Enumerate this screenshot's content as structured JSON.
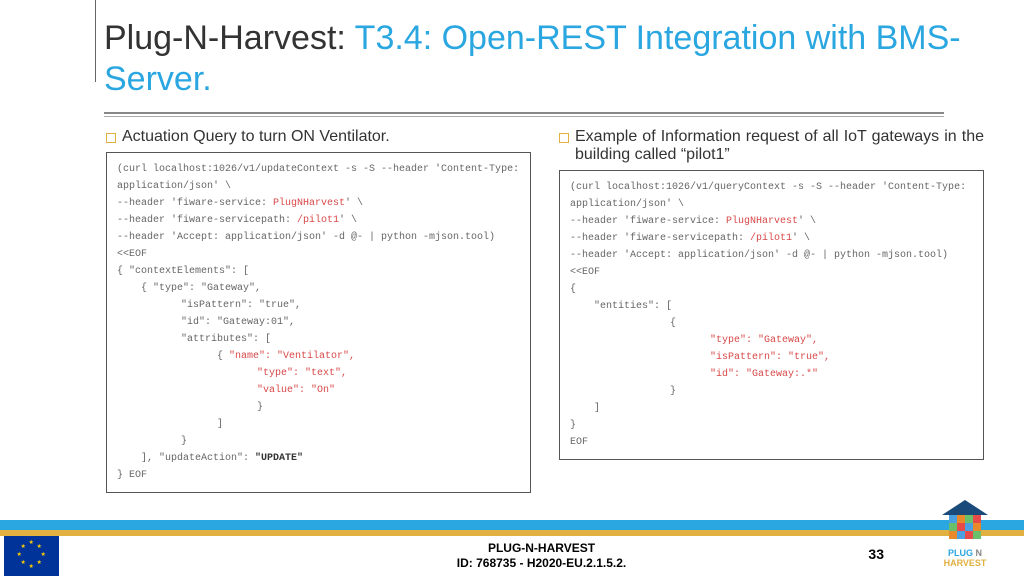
{
  "title": {
    "prefix": "Plug-N-Harvest: ",
    "rest": "T3.4: Open-REST Integration with BMS-Server."
  },
  "left": {
    "heading": "Actuation Query to turn ON Ventilator.",
    "code": {
      "l1a": "(curl localhost:1026/v1/updateContext -s -S --header 'Content-Type: application/json' \\",
      "l2a": "--header 'fiware-service: ",
      "l2b": "PlugNHarvest",
      "l2c": "' \\",
      "l3a": "--header 'fiware-servicepath: ",
      "l3b": "/pilot1",
      "l3c": "' \\",
      "l4": "--header 'Accept: application/json' -d @- | python -mjson.tool) <<EOF",
      "l5": "{    \"contextElements\": [",
      "l6": "{   \"type\": \"Gateway\",",
      "l7": "\"isPattern\": \"true\",",
      "l8": "\"id\": \"Gateway:01\",",
      "l9": "\"attributes\": [",
      "l10a": "{   ",
      "l10b": "\"name\": \"Ventilator\",",
      "l11": "\"type\": \"text\",",
      "l12": "\"value\": \"On\"",
      "l13": "}",
      "l14": "]",
      "l15": "}",
      "l16a": "], \"updateAction\": ",
      "l16b": "\"UPDATE\"",
      "l17": "} EOF"
    }
  },
  "right": {
    "heading": "Example of  Information request of all IoT gateways in the building called “pilot1”",
    "code": {
      "l1a": "(curl  localhost:1026/v1/queryContext  -s  -S  --header  'Content-Type: application/json' \\",
      "l2a": "--header 'fiware-service: ",
      "l2b": "PlugNHarvest",
      "l2c": "' \\",
      "l3a": "--header 'fiware-servicepath: ",
      "l3b": "/pilot1",
      "l3c": "' \\",
      "l4": "--header 'Accept: application/json' -d @- | python -mjson.tool) <<EOF",
      "l5": "{",
      "l6": "\"entities\": [",
      "l7": "{",
      "l8": "\"type\": \"Gateway\",",
      "l9": "\"isPattern\": \"true\",",
      "l10": "\"id\": \"Gateway:.*\"",
      "l11": "}",
      "l12": "]",
      "l13": "}",
      "l14": "EOF"
    }
  },
  "footer": {
    "line1": "PLUG-N-HARVEST",
    "line2": "ID: 768735 - H2020-EU.2.1.5.2.",
    "page": "33"
  },
  "logo": {
    "plug": "PLUG",
    "harvest": "HARVEST"
  }
}
